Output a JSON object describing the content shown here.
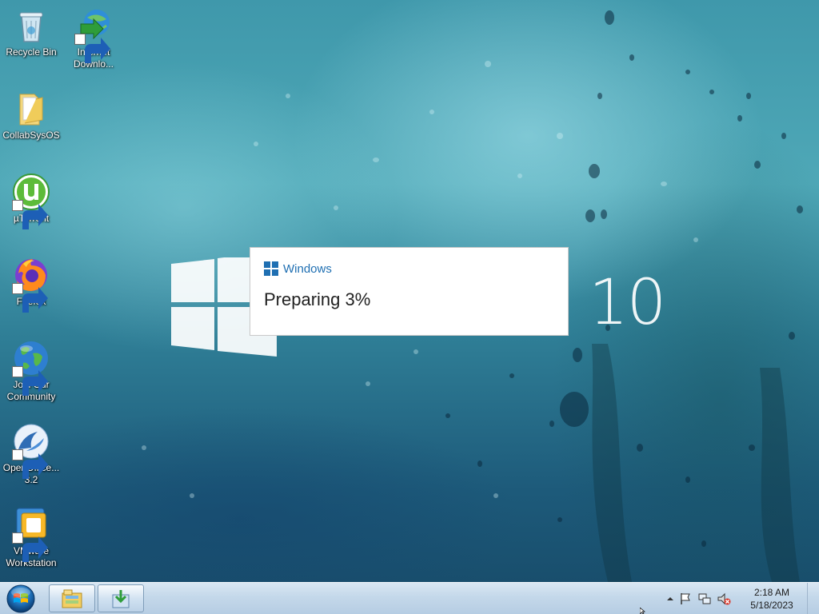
{
  "desktop": {
    "icons": [
      {
        "label": "Recycle Bin",
        "icon": "recycle-bin-icon",
        "shortcut": false
      },
      {
        "label": "Internet Downlo...",
        "icon": "internet-download-manager-icon",
        "shortcut": true
      },
      {
        "label": "CollabSysOS",
        "icon": "folder-icon",
        "shortcut": false
      },
      {
        "label": "µTorrent",
        "icon": "utorrent-icon",
        "shortcut": true
      },
      {
        "label": "Firefox",
        "icon": "firefox-icon",
        "shortcut": true
      },
      {
        "label": "Join Our Community",
        "icon": "globe-icon",
        "shortcut": true
      },
      {
        "label": "OpenOffice... 3.2",
        "icon": "openoffice-icon",
        "shortcut": true
      },
      {
        "label": "VMware Workstation",
        "icon": "vmware-icon",
        "shortcut": true
      }
    ],
    "wallpaper": {
      "logo_text": "10",
      "logo_icon": "windows-logo-icon"
    }
  },
  "dialog": {
    "title": "Windows",
    "status_text": "Preparing 3%",
    "progress_percent": 3,
    "accent_color": "#1f6fb2"
  },
  "taskbar": {
    "start_icon": "windows-start-orb-icon",
    "pinned": [
      {
        "name": "file-explorer",
        "icon": "folder-library-icon"
      },
      {
        "name": "setup-task",
        "icon": "install-setup-icon"
      }
    ],
    "tray": {
      "icons": [
        "show-hidden-icons-arrow",
        "action-center-flag-icon",
        "network-icon",
        "volume-muted-icon"
      ],
      "time": "2:18 AM",
      "date": "5/18/2023"
    }
  }
}
